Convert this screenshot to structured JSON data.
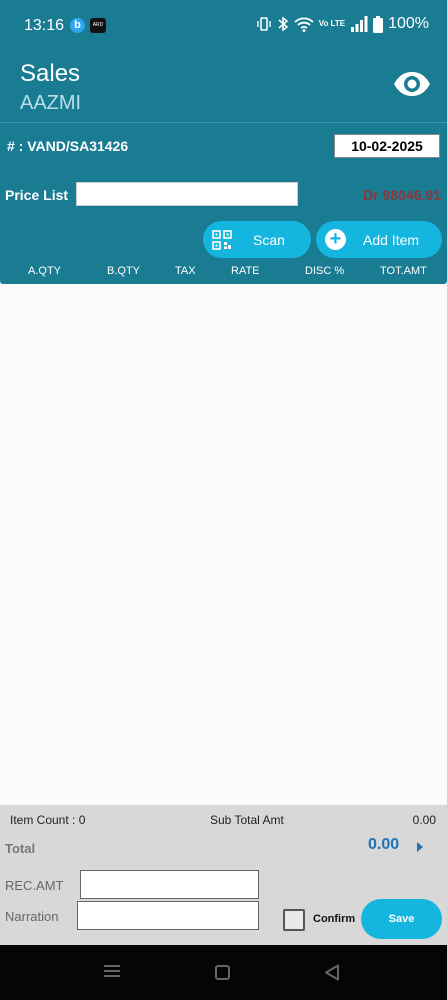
{
  "status_bar": {
    "time": "13:16",
    "app1_letter": "b",
    "app2_text": "ARD",
    "volte": "Vo LTE",
    "battery": "100%",
    "icons": [
      "vibrate-icon",
      "bluetooth-icon",
      "wifi-icon",
      "signal-icon",
      "battery-icon"
    ]
  },
  "header": {
    "title": "Sales",
    "subtitle": "AAZMI",
    "preview_icon": "eye-icon"
  },
  "form": {
    "voucher_no": "# : VAND/SA31426",
    "date": "10-02-2025",
    "price_list_label": "Price List",
    "price_list_value": "",
    "balance": "Dr 98046.91",
    "scan_label": "Scan",
    "add_item_label": "Add Item"
  },
  "table": {
    "columns": [
      "A.QTY",
      "B.QTY",
      "TAX",
      "RATE",
      "DISC %",
      "TOT.AMT"
    ],
    "rows": []
  },
  "footer": {
    "item_count": "Item Count : 0",
    "subtotal_label": "Sub Total Amt",
    "subtotal_value": "0.00",
    "total_label": "Total",
    "total_value": "0.00",
    "rec_amt_label": "REC.AMT",
    "rec_amt_value": "",
    "narration_label": "Narration",
    "narration_value": "",
    "confirm_label": "Confirm",
    "save_label": "Save"
  },
  "colors": {
    "primary": "#1a7c93",
    "accent": "#14b6df",
    "balance": "#b71c1c",
    "total": "#1f73b7"
  }
}
